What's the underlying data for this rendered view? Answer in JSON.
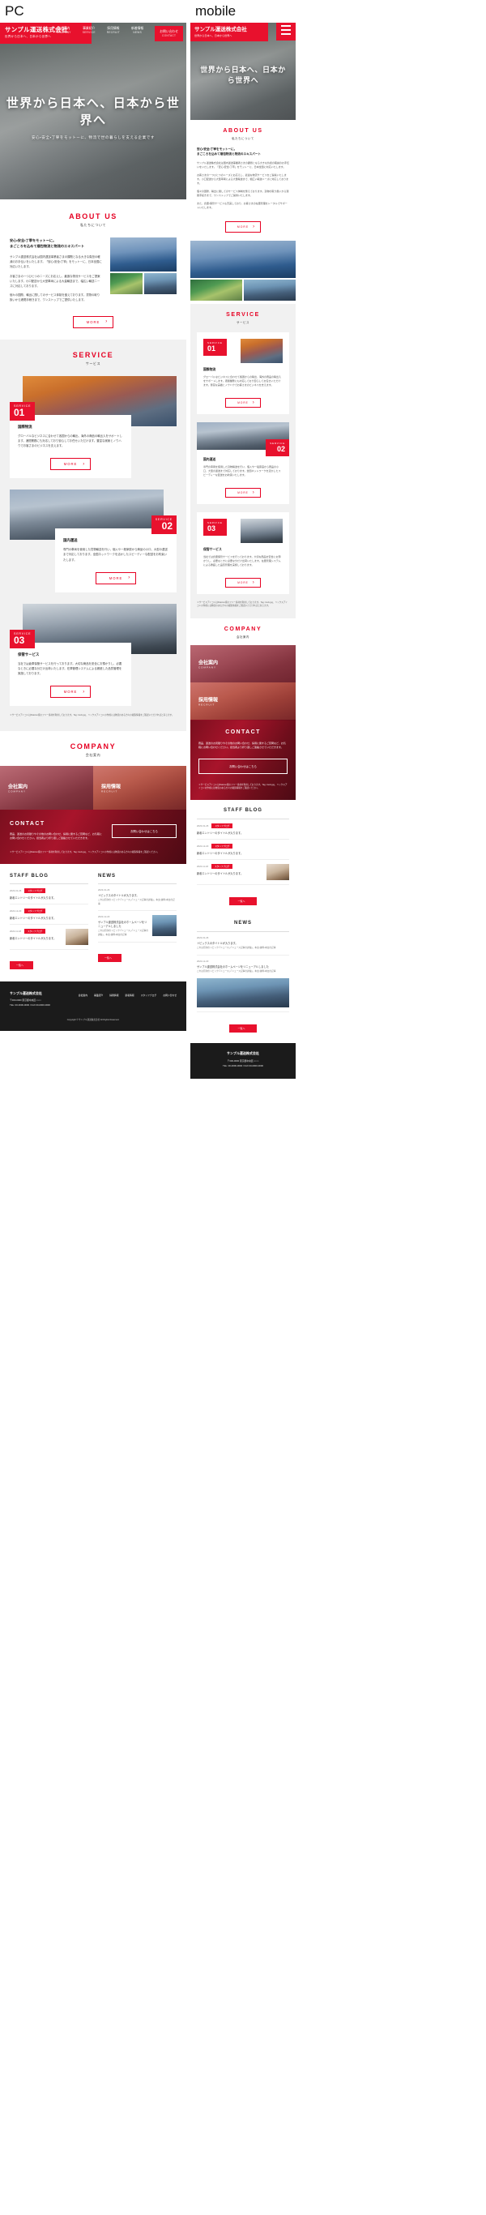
{
  "labels": {
    "pc": "PC",
    "mobile": "mobile"
  },
  "site": {
    "company_name": "サンプル運送株式会社",
    "tagline": "世界から日本へ、日本から世界へ",
    "accent_color": "#e8112d",
    "dark_color": "#1b1b1b"
  },
  "nav": {
    "items": [
      {
        "jp": "会社案内",
        "en": "COMPANY"
      },
      {
        "jp": "事業紹介",
        "en": "SERVICE"
      },
      {
        "jp": "採用情報",
        "en": "RECRUIT"
      },
      {
        "jp": "新着情報",
        "en": "NEWS"
      }
    ],
    "cta": {
      "jp": "お問い合わせ",
      "en": "CONTACT"
    }
  },
  "hero": {
    "headline": "世界から日本へ、日本から世界へ",
    "subcopy": "安心・安全・丁寧をモットーに、物流で世の暮らしを支える企業です"
  },
  "about": {
    "en": "ABOUT US",
    "jp": "私たちについて",
    "lead": "安心・安全・丁寧をモットーに。\nまごころを込めて梱包物流と物流のエキスパート",
    "body1": "サンプル運送株式会社は国内運送事業者さまの課題となる大きな負担の軽減のお手伝いをいたします。「安心・安全・丁寧」をモットーに、日本全国に対応いたします。",
    "body2": "お客さまの一つひとつのニーズにお応えし、最適な物流サービスをご提案いたします。小口配送から大型車両による大量輸送まで、幅広い輸送ニーズに対応しております。",
    "body3": "個々の国際、輸出に関してのサービス体制を整えております。貨物の取り扱いから通関手続きまで、ワンストップでご提供いたします。",
    "body4": "また、倉庫・保管サービスも充実しており、お客さまの在庫管理をトータルでサポートいたします。",
    "more": "MORE"
  },
  "service": {
    "en": "SERVICE",
    "jp": "サービス",
    "items": [
      {
        "label": "SERVICE",
        "number": "01",
        "title": "国際物流",
        "body": "グローバルなビジネスに合わせて各国からの輸出、海外の商品の輸出入をサポートします。通関業務にも対応しており安心してお任せいただけます。豊富な実績とノウハウでお客さまのビジネスを支えます。",
        "more": "MORE"
      },
      {
        "label": "SERVICE",
        "number": "02",
        "title": "国内運送",
        "body": "専門の車両を使用した貨物輸送を行い、個人や一般家庭から商品の小口、大型の運送まで対応しております。全国ネットワークを活かしたスピーディーな配送をお約束いたします。",
        "more": "MORE"
      },
      {
        "label": "SERVICE",
        "number": "03",
        "title": "保管サービス",
        "body": "当社では倉庫保管サービスを行っております。大切な商品を安全にお預かりし、必要なときに必要な分だけ出荷いたします。在庫管理システムによる徹底した品質管理を実施しております。",
        "more": "MORE"
      }
    ],
    "credit": "＊サービスアイコンはFlaticon様のフリー素材を利用しております。Tag: truck.jpg、ミックスアイコンの作成には物流のある方々の撮影情報をご確認いただければと存じます。"
  },
  "company": {
    "en": "COMPANY",
    "jp": "会社案内",
    "cards": [
      {
        "title": "会社案内",
        "en": "COMPANY"
      },
      {
        "title": "採用情報",
        "en": "RECRUIT"
      }
    ]
  },
  "contact": {
    "heading": "CONTACT",
    "body": "商品、運送のお見積りやその他のお問い合わせ、採用に関するご質問など、お気軽にお問い合わせください。担当者より折り返しご連絡させていただきます。",
    "button": "お問い合わせはこちら",
    "credit": "＊サービスアイコンはFlaticon様のフリー素材を利用しております。Tag: truck.jpg、ミックスアイコンの作成には物流のある方々の撮影情報をご確認ください。"
  },
  "blog": {
    "heading": "STAFF BLOG",
    "posts": [
      {
        "date": "2023-01-26",
        "cat": "スタッフブログ",
        "title": "新着エントリーのタイトルが入ります。"
      },
      {
        "date": "2022-12-20",
        "cat": "スタッフブログ",
        "title": "新着エントリーのタイトルが入ります。"
      },
      {
        "date": "2022-11-18",
        "cat": "スタッフブログ",
        "title": "新着エントリーのタイトルが入ります。"
      }
    ],
    "more": "一覧へ"
  },
  "news": {
    "heading": "NEWS",
    "posts": [
      {
        "date": "2023-01-26",
        "title": "トピックスのタイトルが入ります。",
        "body": "これは月次のトピック・「ニュース」・「ニュース記事の詳細」。本文・抜粋・本文の記事"
      },
      {
        "date": "2022-12-20",
        "title": "サンプル運送株式会社のホームページをリニューアルしました",
        "body": "これは月次のトピック・「ニュース」・「ニュース記事の詳細」。本文・抜粋・本文の記事"
      }
    ],
    "more": "一覧へ"
  },
  "footer": {
    "company_name": "サンプル運送株式会社",
    "address": "〒000-0000 東京都中央区○○○○",
    "tel": "TEL: 00-0000-0000 / FAX 00-0000-0000",
    "links": [
      "会社案内",
      "事業紹介",
      "採用情報",
      "新着情報",
      "スタッフブログ",
      "お問い合わせ"
    ],
    "copyright": "Copyright © サンプル運送株式会社 All Rights Reserved."
  }
}
